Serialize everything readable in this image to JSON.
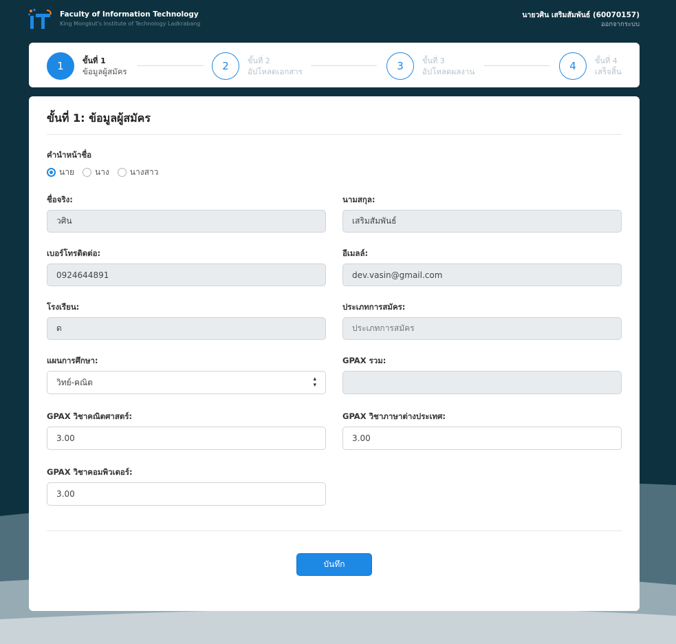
{
  "header": {
    "brand_title": "Faculty of Information Technology",
    "brand_subtitle": "King Mongkut's Institute of Technology Ladkrabang",
    "user_name": "นายวศิน เสริมสัมพันธ์ (60070157)",
    "logout_label": "ออกจากระบบ"
  },
  "stepper": {
    "steps": [
      {
        "number": "1",
        "title": "ขั้นที่ 1",
        "label": "ข้อมูลผู้สมัคร",
        "active": true
      },
      {
        "number": "2",
        "title": "ขั้นที่ 2",
        "label": "อัปโหลดเอกสาร",
        "active": false
      },
      {
        "number": "3",
        "title": "ขั้นที่ 3",
        "label": "อัปโหลดผลงาน",
        "active": false
      },
      {
        "number": "4",
        "title": "ขั้นที่ 4",
        "label": "เสร็จสิ้น",
        "active": false
      }
    ]
  },
  "form": {
    "title": "ขั้นที่ 1: ข้อมูลผู้สมัคร",
    "prefix_label": "คำนำหน้าชื่อ",
    "prefix_options": [
      "นาย",
      "นาง",
      "นางสาว"
    ],
    "prefix_selected": "นาย",
    "firstname_label": "ชื่อจริง:",
    "firstname_value": "วศิน",
    "lastname_label": "นามสกุล:",
    "lastname_value": "เสริมสัมพันธ์",
    "phone_label": "เบอร์โทรติดต่อ:",
    "phone_value": "0924644891",
    "email_label": "อีเมลล์:",
    "email_value": "dev.vasin@gmail.com",
    "school_label": "โรงเรียน:",
    "school_value": "ด",
    "apptype_label": "ประเภทการสมัคร:",
    "apptype_placeholder": "ประเภทการสมัคร",
    "plan_label": "แผนการศึกษา:",
    "plan_value": "วิทย์-คณิต",
    "gpax_total_label": "GPAX รวม:",
    "gpax_total_value": "",
    "gpax_math_label": "GPAX วิชาคณิตศาสตร์:",
    "gpax_math_value": "3.00",
    "gpax_lang_label": "GPAX วิชาภาษาต่างประเทศ:",
    "gpax_lang_value": "3.00",
    "gpax_comp_label": "GPAX วิชาคอมพิวเตอร์:",
    "gpax_comp_value": "3.00",
    "save_label": "บันทึก"
  },
  "colors": {
    "background": "#0e3140",
    "accent": "#1e88e5",
    "readonly_field": "#e9ecef"
  },
  "icons": {
    "logo": "it-logo-icon",
    "select_arrow": "chevron-updown-icon"
  }
}
